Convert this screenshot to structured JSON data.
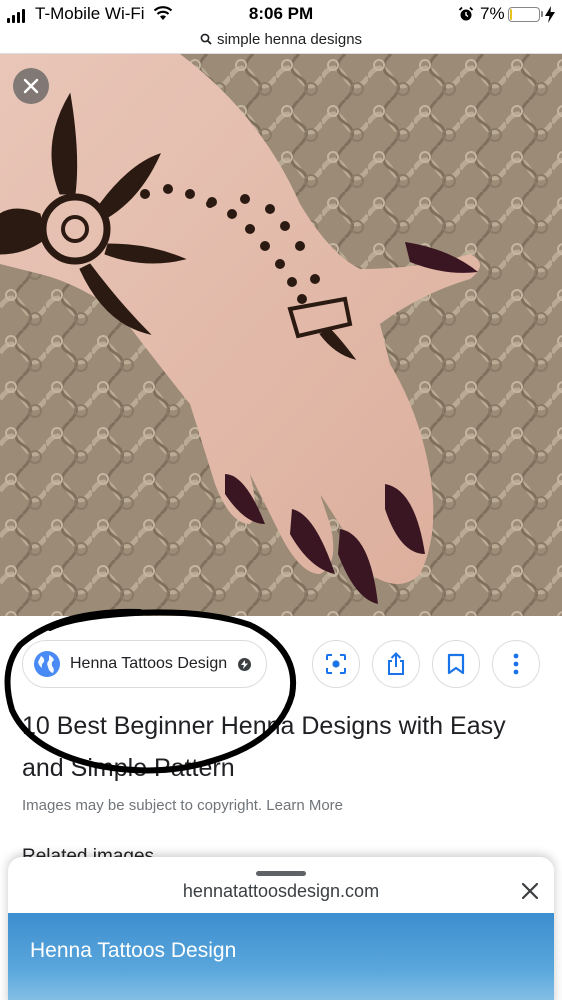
{
  "status_bar": {
    "carrier": "T-Mobile Wi-Fi",
    "time": "8:06 PM",
    "battery_percent": "7%",
    "battery_level": 0.07,
    "battery_color": "#e8c21d",
    "icons": [
      "signal-icon",
      "wifi-icon",
      "alarm-icon",
      "battery-icon",
      "charging-bolt-icon"
    ]
  },
  "search": {
    "query": "simple henna designs",
    "icon": "search-icon"
  },
  "viewer": {
    "close_icon": "close-icon",
    "image_description_hidden": ""
  },
  "source": {
    "name": "Henna Tattoos Design",
    "icon": "globe-icon",
    "badge_icon": "amp-bolt-icon"
  },
  "actions": [
    {
      "name": "lens",
      "icon": "lens-icon"
    },
    {
      "name": "share",
      "icon": "share-icon"
    },
    {
      "name": "save",
      "icon": "bookmark-icon"
    },
    {
      "name": "more",
      "icon": "more-vert-icon"
    }
  ],
  "result": {
    "title": "10 Best Beginner Henna Designs with Easy and Simple Pattern",
    "copyright_text": "Images may be subject to copyright.",
    "learn_more": "Learn More",
    "related_heading": "Related images"
  },
  "sheet": {
    "domain": "hennatattoosdesign.com",
    "banner_title": "Henna Tattoos Design",
    "close_icon": "close-icon"
  },
  "colors": {
    "accent_blue": "#1a73e8",
    "banner_blue": "#3d8ecf",
    "nail_color": "#3a1622"
  }
}
